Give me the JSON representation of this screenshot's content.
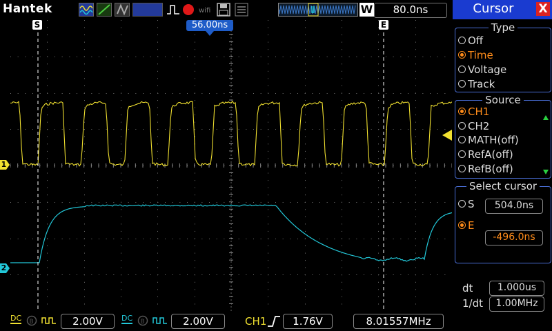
{
  "brand": "Hantek",
  "header": {
    "timebase": "80.0ns",
    "trigger_position_label": "56.00ns",
    "window_label": "W"
  },
  "markers": {
    "s_cursor": "S",
    "e_cursor": "E",
    "ch1_marker": "1",
    "ch2_marker": "2"
  },
  "panel": {
    "title": "Cursor",
    "close": "X",
    "type_group": {
      "title": "Type",
      "options": [
        "Off",
        "Time",
        "Voltage",
        "Track"
      ],
      "selected": "Time"
    },
    "source_group": {
      "title": "Source",
      "options": [
        "CH1",
        "CH2",
        "MATH(off)",
        "RefA(off)",
        "RefB(off)"
      ],
      "selected": "CH1"
    },
    "select_group": {
      "title": "Select cursor",
      "s_label": "S",
      "s_value": "504.0ns",
      "e_label": "E",
      "e_value": "-496.0ns"
    },
    "dt_label": "dt",
    "dt_value": "1.000us",
    "inv_dt_label": "1/dt",
    "inv_dt_value": "1.00MHz"
  },
  "footer": {
    "ch1_coupling": "DC",
    "ch1_scale": "2.00V",
    "ch2_coupling": "DC",
    "ch2_scale": "2.00V",
    "trigger_source": "CH1",
    "trigger_level": "1.76V",
    "frequency": "8.01557MHz"
  },
  "colors": {
    "ch1": "#f0e030",
    "ch2": "#22c7d8",
    "accent": "#1a3bd0",
    "selected": "#ff8c1a",
    "close": "#dd2222"
  }
}
